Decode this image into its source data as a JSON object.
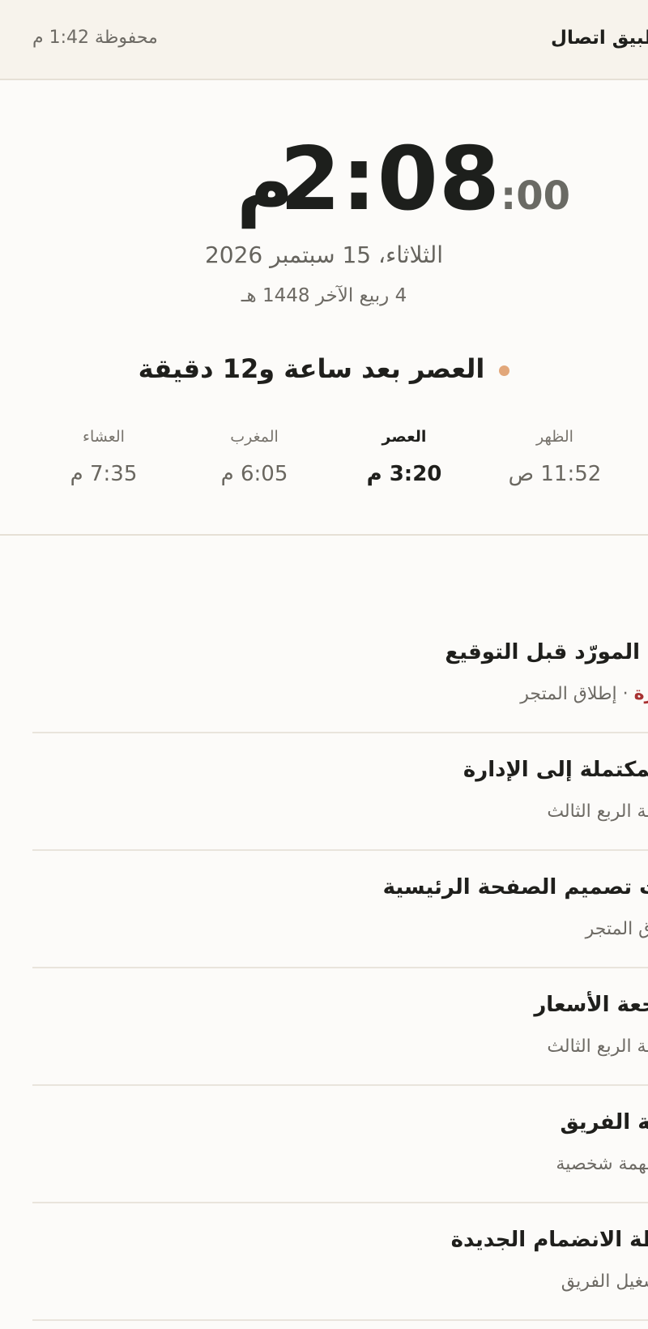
{
  "topbar": {
    "title": "تطبيق اتصال",
    "saved_status": "محفوظة 1:42 م"
  },
  "clock": {
    "time": "2:08",
    "seconds": ":00",
    "ampm": "م",
    "date": "الثلاثاء، 15 سبتمبر 2026",
    "hijri": "4 ربيع الآخر 1448 هـ"
  },
  "next_prayer": {
    "text": "العصر بعد ساعة و12 دقيقة",
    "dot_color": "#e2a77a"
  },
  "prayers": [
    {
      "name": "الظهر",
      "time": "11:52 ص",
      "active": false
    },
    {
      "name": "العصر",
      "time": "3:20 م",
      "active": true
    },
    {
      "name": "المغرب",
      "time": "6:05 م",
      "active": false
    },
    {
      "name": "العشاء",
      "time": "7:35 م",
      "active": false
    }
  ],
  "tasks": [
    {
      "title": "مراجعة عقد المورّد قبل التوقيع",
      "status": "متأخرة",
      "sub": " · إطلاق المتجر"
    },
    {
      "title": "إرسال التقارير المكتملة إلى الإدارة",
      "status": "",
      "sub": "خطة الربع الثالث"
    },
    {
      "title": "تحديث تصميم الصفحة الرئيسية",
      "status": "",
      "sub": "إطلاق المتجر"
    },
    {
      "title": "مراجعة الأسعار",
      "status": "",
      "sub": "خطة الربع الثالث"
    },
    {
      "title": "اجتماع مع رئيسة الفريق",
      "status": "",
      "sub": "مهمة شخصية"
    },
    {
      "title": "إعداد خطة الانضمام الجديدة",
      "status": "",
      "sub": "تشغيل الفريق"
    }
  ],
  "colors": {
    "background": "#fcfbf9",
    "topbar": "#f7f3ec",
    "overdue": "#a83232",
    "accent_dot": "#e2a77a"
  }
}
